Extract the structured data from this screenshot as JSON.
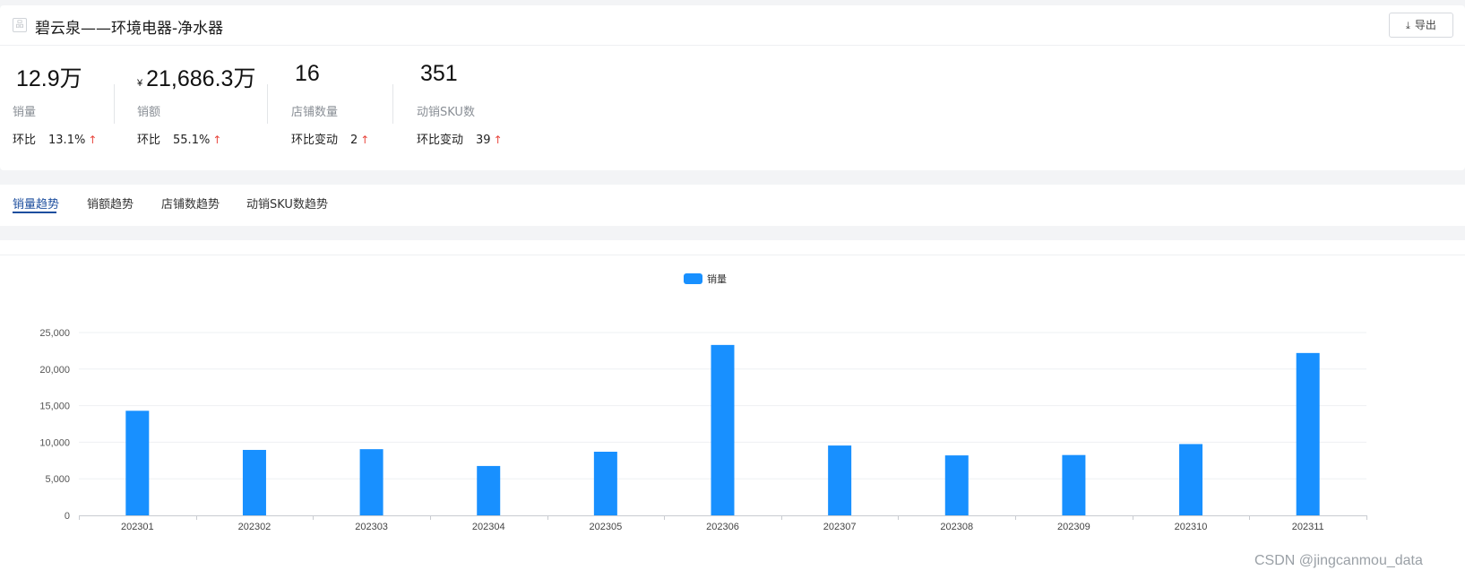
{
  "header": {
    "title": "碧云泉——环境电器-净水器",
    "export_label": "导出"
  },
  "metrics": [
    {
      "value": "12.9万",
      "currency": "",
      "label": "销量",
      "cmp_label": "环比",
      "cmp_value": "13.1%",
      "arrow": "↑"
    },
    {
      "value": "21,686.3万",
      "currency": "¥",
      "label": "销额",
      "cmp_label": "环比",
      "cmp_value": "55.1%",
      "arrow": "↑"
    },
    {
      "value": "16",
      "currency": "",
      "label": "店铺数量",
      "cmp_label": "环比变动",
      "cmp_value": "2",
      "arrow": "↑"
    },
    {
      "value": "351",
      "currency": "",
      "label": "动销SKU数",
      "cmp_label": "环比变动",
      "cmp_value": "39",
      "arrow": "↑"
    }
  ],
  "tabs": [
    {
      "label": "销量趋势",
      "active": true
    },
    {
      "label": "销额趋势",
      "active": false
    },
    {
      "label": "店铺数趋势",
      "active": false
    },
    {
      "label": "动销SKU数趋势",
      "active": false
    }
  ],
  "chart_data": {
    "type": "bar",
    "categories": [
      "202301",
      "202302",
      "202303",
      "202304",
      "202305",
      "202306",
      "202307",
      "202308",
      "202309",
      "202310",
      "202311"
    ],
    "series": [
      {
        "name": "销量",
        "color": "#1890ff",
        "values": [
          14300,
          8950,
          9050,
          6750,
          8700,
          23300,
          9550,
          8200,
          8250,
          9750,
          22200
        ]
      }
    ],
    "ylim": [
      0,
      25000
    ],
    "yticks": [
      "0",
      "5,000",
      "10,000",
      "15,000",
      "20,000",
      "25,000"
    ],
    "grid": true,
    "legend": "top-center"
  },
  "watermark": "CSDN @jingcanmou_data"
}
